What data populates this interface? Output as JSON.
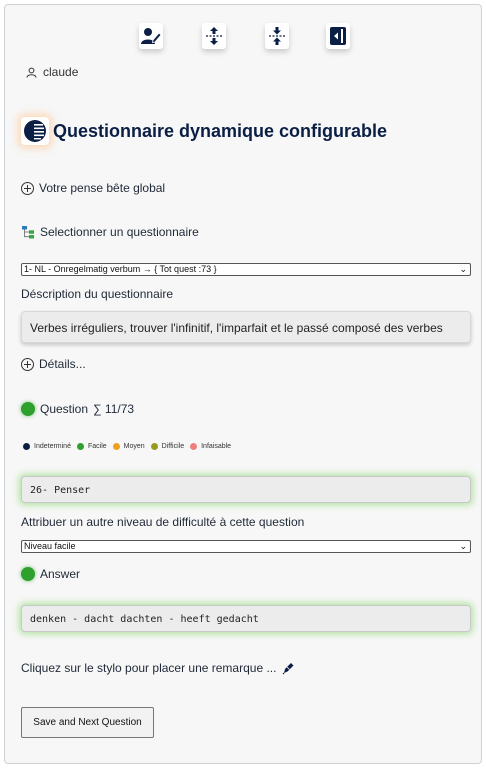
{
  "toolbar": {
    "icons": [
      "user-edit-icon",
      "expand-vertical-icon",
      "collapse-vertical-icon",
      "sidebar-toggle-icon"
    ]
  },
  "user": {
    "name": "claude"
  },
  "app": {
    "title": "Questionnaire dynamique configurable"
  },
  "memo": {
    "label": "Votre pense bête global"
  },
  "questionnaire": {
    "label": "Selectionner un questionnaire",
    "selected": "1- NL - Onregelmatig verbum → { Tot quest :73 }",
    "description_label": "Déscription du questionnaire",
    "description": "Verbes irréguliers, trouver l'infinitif, l'imparfait et le passé composé des verbes",
    "details_label": "Détails..."
  },
  "question": {
    "label": "Question",
    "progress": "∑ 11/73",
    "text": "26- Penser",
    "status_color": "#2ea02e"
  },
  "legend": [
    {
      "label": "Indeterminé",
      "color": "#0b1f45"
    },
    {
      "label": "Facile",
      "color": "#2ea02e"
    },
    {
      "label": "Moyen",
      "color": "#f0a020"
    },
    {
      "label": "Difficile",
      "color": "#9a9a20"
    },
    {
      "label": "Infaisable",
      "color": "#f08080"
    }
  ],
  "difficulty": {
    "label": "Attribuer un autre niveau de difficulté à cette question",
    "selected": "Niveau facile"
  },
  "answer": {
    "label": "Answer",
    "text": "denken - dacht dachten - heeft gedacht"
  },
  "remark": {
    "label": "Cliquez sur le stylo pour placer une remarque ..."
  },
  "actions": {
    "save_next": "Save and Next Question"
  }
}
